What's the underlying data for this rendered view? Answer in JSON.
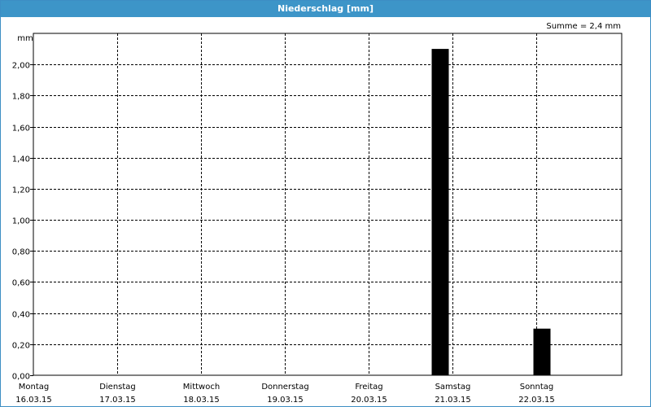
{
  "title": "Niederschlag [mm]",
  "summary": "Summe = 2,4 mm",
  "chart_data": {
    "type": "bar",
    "title": "Niederschlag [mm]",
    "ylabel": "mm",
    "xlabel": "",
    "ylim": [
      0,
      2.2
    ],
    "yticks": [
      "0,00",
      "0,20",
      "0,40",
      "0,60",
      "0,80",
      "1,00",
      "1,20",
      "1,40",
      "1,60",
      "1,80",
      "2,00"
    ],
    "categories": [
      {
        "day": "Montag",
        "date": "16.03.15"
      },
      {
        "day": "Dienstag",
        "date": "17.03.15"
      },
      {
        "day": "Mittwoch",
        "date": "18.03.15"
      },
      {
        "day": "Donnerstag",
        "date": "19.03.15"
      },
      {
        "day": "Freitag",
        "date": "20.03.15"
      },
      {
        "day": "Samstag",
        "date": "21.03.15"
      },
      {
        "day": "Sonntag",
        "date": "22.03.15"
      }
    ],
    "values": [
      0,
      0,
      0,
      0,
      0,
      2.1,
      0.3
    ],
    "bar_color": "#000000",
    "grid": true
  }
}
